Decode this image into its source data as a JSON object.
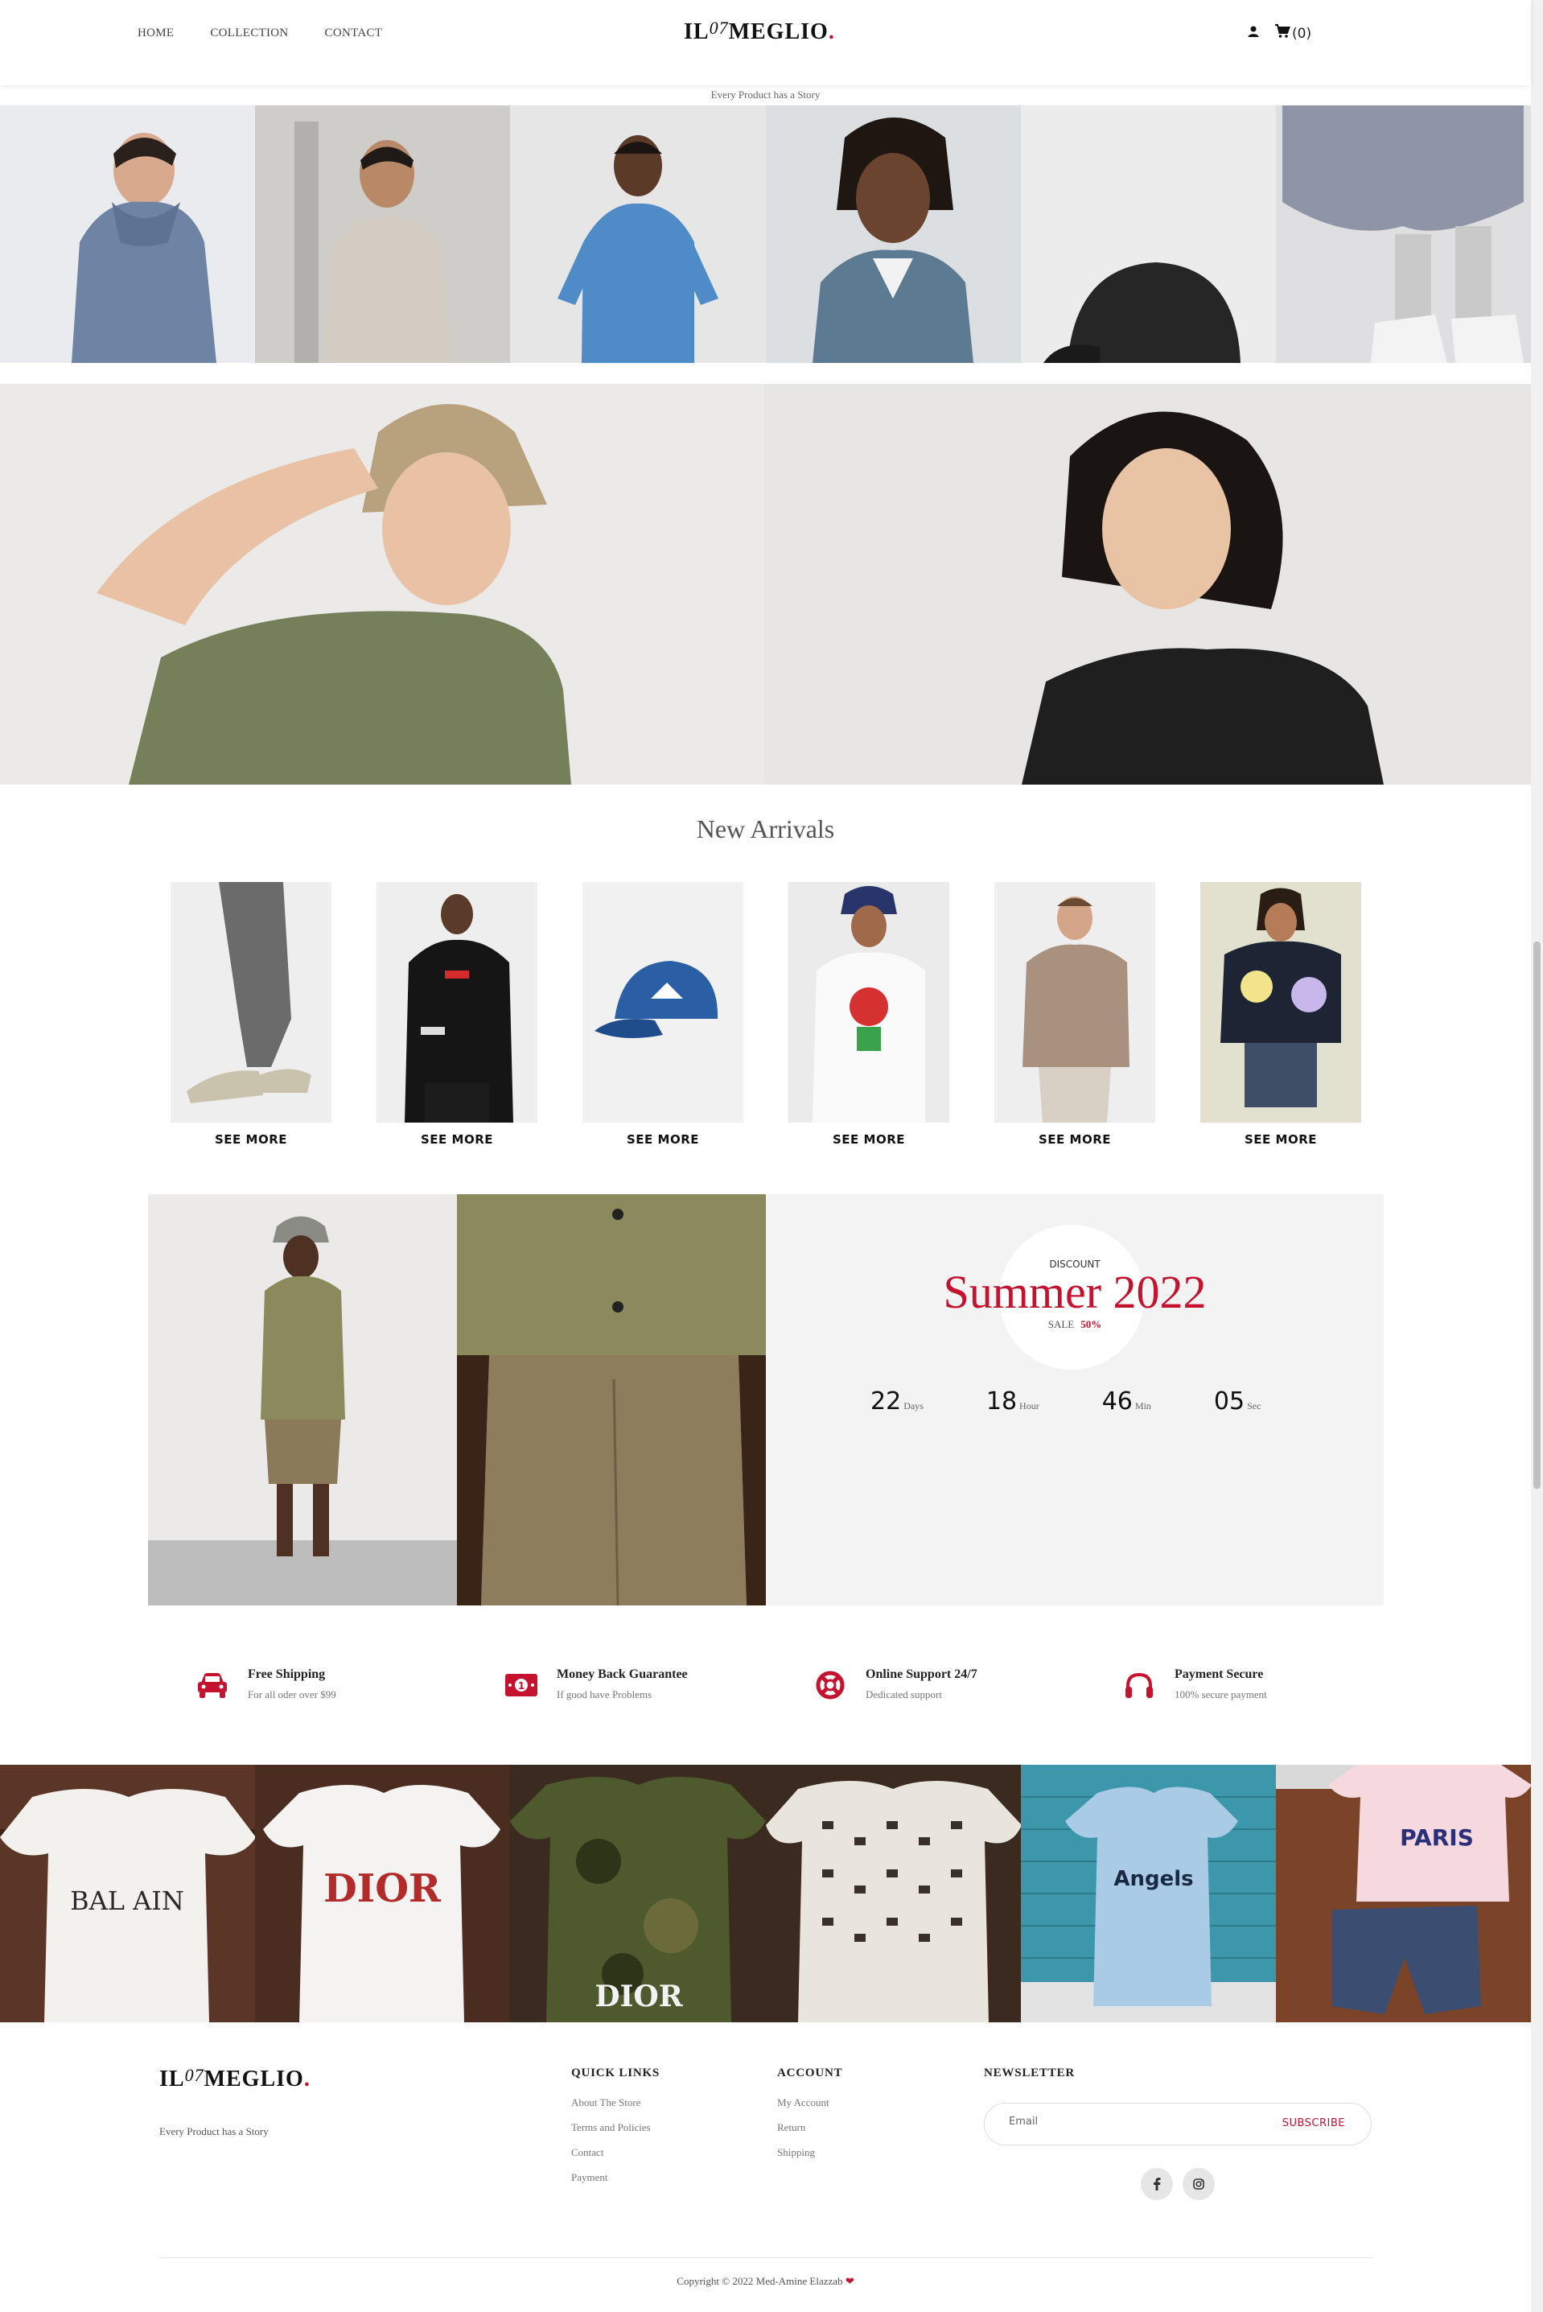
{
  "header": {
    "nav": [
      "HOME",
      "COLLECTION",
      "CONTACT"
    ],
    "logo": {
      "left": "IL",
      "num": "07",
      "right": "MEGLIO",
      "dot": "."
    },
    "cart_count": "(0)",
    "tagline": "Every Product has a Story"
  },
  "arrivals": {
    "title": "New Arrivals",
    "items": [
      {
        "label": "SEE MORE"
      },
      {
        "label": "SEE MORE"
      },
      {
        "label": "SEE MORE"
      },
      {
        "label": "SEE MORE"
      },
      {
        "label": "SEE MORE"
      },
      {
        "label": "SEE MORE"
      }
    ]
  },
  "sale": {
    "discount_label": "DISCOUNT",
    "title": "Summer 2022",
    "sale_label": "SALE",
    "sale_pct": "50%",
    "countdown": [
      {
        "value": "22",
        "unit": "Days"
      },
      {
        "value": "18",
        "unit": "Hour"
      },
      {
        "value": "46",
        "unit": "Min"
      },
      {
        "value": "05",
        "unit": "Sec"
      }
    ]
  },
  "features": [
    {
      "title": "Free Shipping",
      "sub": "For all oder over $99",
      "icon": "car-icon"
    },
    {
      "title": "Money Back Guarantee",
      "sub": "If good have Problems",
      "icon": "money-icon"
    },
    {
      "title": "Online Support 24/7",
      "sub": "Dedicated support",
      "icon": "lifebuoy-icon"
    },
    {
      "title": "Payment Secure",
      "sub": "100% secure payment",
      "icon": "headphones-icon"
    }
  ],
  "footer": {
    "tagline": "Every Product has a Story",
    "quick_links": {
      "title": "QUICK LINKS",
      "items": [
        "About The Store",
        "Terms and Policies",
        "Contact",
        "Payment"
      ]
    },
    "account": {
      "title": "ACCOUNT",
      "items": [
        "My Account",
        "Return",
        "Shipping"
      ]
    },
    "newsletter": {
      "title": "NEWSLETTER",
      "placeholder": "Email",
      "button": "SUBSCRIBE"
    },
    "copyright": "Copyright © 2022 Med-Amine Elazzab"
  },
  "colors": {
    "accent": "#c4122f"
  }
}
